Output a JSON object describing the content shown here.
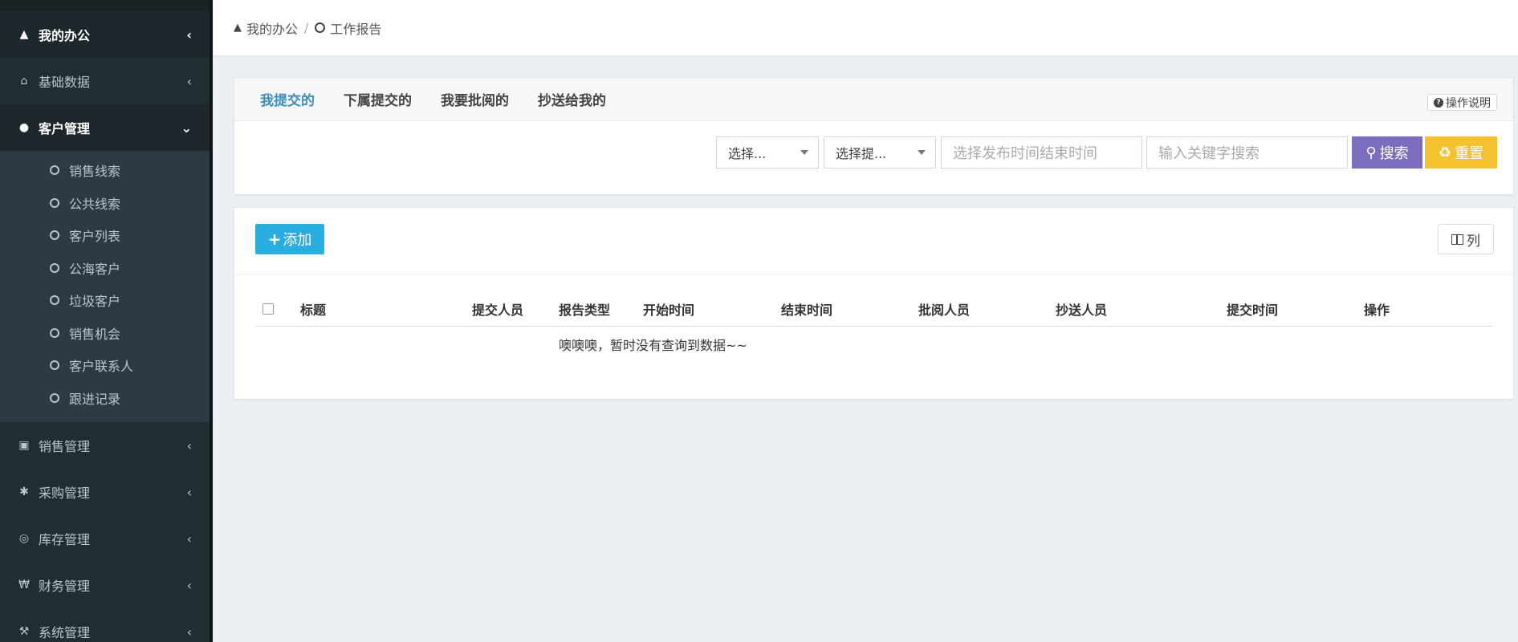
{
  "sidebar": {
    "top_item": {
      "label": "我的办公",
      "icon": "road-icon"
    },
    "items": [
      {
        "label": "基础数据",
        "icon": "home-icon"
      },
      {
        "label": "客户管理",
        "icon": "user-icon"
      },
      {
        "label": "销售管理",
        "icon": "cart-icon"
      },
      {
        "label": "采购管理",
        "icon": "asterisk-icon"
      },
      {
        "label": "库存管理",
        "icon": "target-icon"
      },
      {
        "label": "财务管理",
        "icon": "won-icon"
      },
      {
        "label": "系统管理",
        "icon": "wrench-icon"
      }
    ],
    "submenu": [
      "销售线索",
      "公共线索",
      "客户列表",
      "公海客户",
      "垃圾客户",
      "销售机会",
      "客户联系人",
      "跟进记录"
    ]
  },
  "breadcrumb": {
    "home": "我的办公",
    "sep": "/",
    "current": "工作报告"
  },
  "tabs": [
    "我提交的",
    "下属提交的",
    "我要批阅的",
    "抄送给我的"
  ],
  "help_label": "操作说明",
  "filters": {
    "select1": "选择...",
    "select2": "选择提...",
    "date_placeholder": "选择发布时间结束时间",
    "keyword_placeholder": "输入关键字搜索",
    "search_label": "搜索",
    "reset_label": "重置"
  },
  "toolbar": {
    "add_label": "添加",
    "columns_label": "列"
  },
  "table": {
    "headers": [
      "标题",
      "提交人员",
      "报告类型",
      "开始时间",
      "结束时间",
      "批阅人员",
      "抄送人员",
      "提交时间",
      "操作"
    ],
    "empty_text": "噢噢噢，暂时没有查询到数据~~"
  },
  "colors": {
    "sidebar_bg": "#222d32",
    "accent_blue": "#3c8dbc",
    "search_purple": "#7d6dbf",
    "reset_yellow": "#f5c22f",
    "add_cyan": "#2aaee1"
  }
}
